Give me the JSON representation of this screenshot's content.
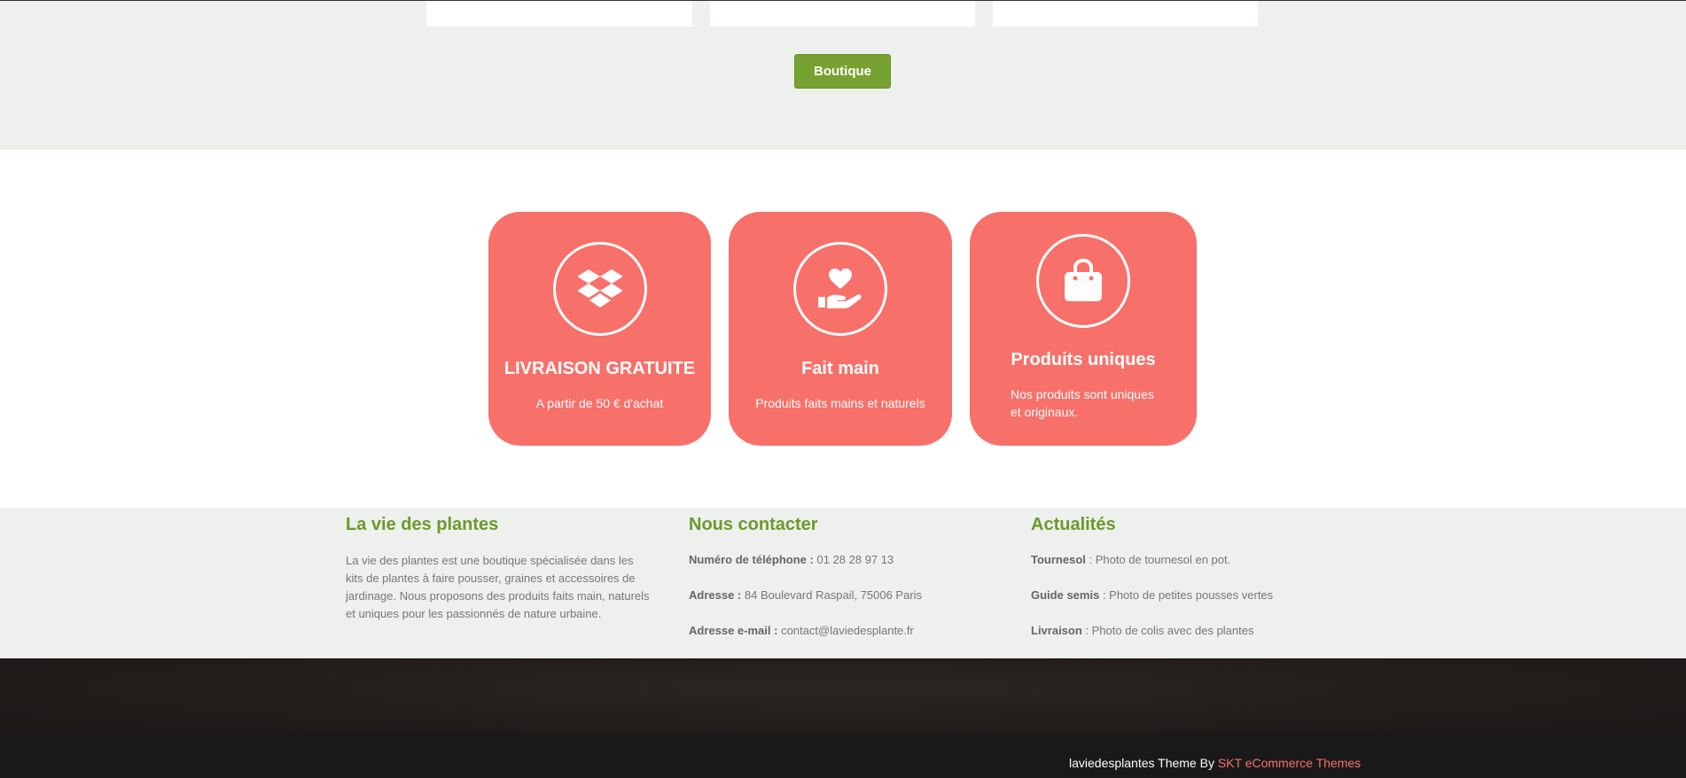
{
  "shop": {
    "button_label": "Boutique"
  },
  "features": [
    {
      "icon": "dropbox-icon",
      "title": "LIVRAISON GRATUITE",
      "text": "A partir de 50 € d'achat"
    },
    {
      "icon": "heart-hand-icon",
      "title": "Fait main",
      "text": "Produits faits mains et naturels"
    },
    {
      "icon": "shopping-bag-icon",
      "title": "Produits uniques",
      "text": "Nos produits sont uniques et originaux."
    }
  ],
  "footer": {
    "about": {
      "title": "La vie des plantes",
      "text": "La vie des plantes est une boutique spécialisée dans les kits de plantes à faire pousser, graines et accessoires de jardinage. Nous proposons des produits faits main, naturels et uniques pour les passionnés de nature urbaine."
    },
    "contact": {
      "title": "Nous contacter",
      "phone_label": "Numéro de téléphone :",
      "phone": "01 28 28 97 13",
      "address_label": "Adresse :",
      "address": "84 Boulevard Raspail, 75006 Paris",
      "email_label": "Adresse e-mail :",
      "email": "contact@laviedesplante.fr"
    },
    "news": {
      "title": "Actualités",
      "items": [
        {
          "label": "Tournesol",
          "text": ": Photo de tournesol en pot."
        },
        {
          "label": "Guide semis",
          "text": ": Photo de petites pousses vertes"
        },
        {
          "label": "Livraison",
          "text": ": Photo de colis avec des plantes"
        }
      ]
    }
  },
  "credit": {
    "site": "laviedesplantes Theme By",
    "link": "SKT eCommerce Themes"
  },
  "colors": {
    "accent_green": "#77a131",
    "heading_green": "#6b9a2a",
    "feature_coral": "#f8706a",
    "link_coral": "#f8706a"
  }
}
